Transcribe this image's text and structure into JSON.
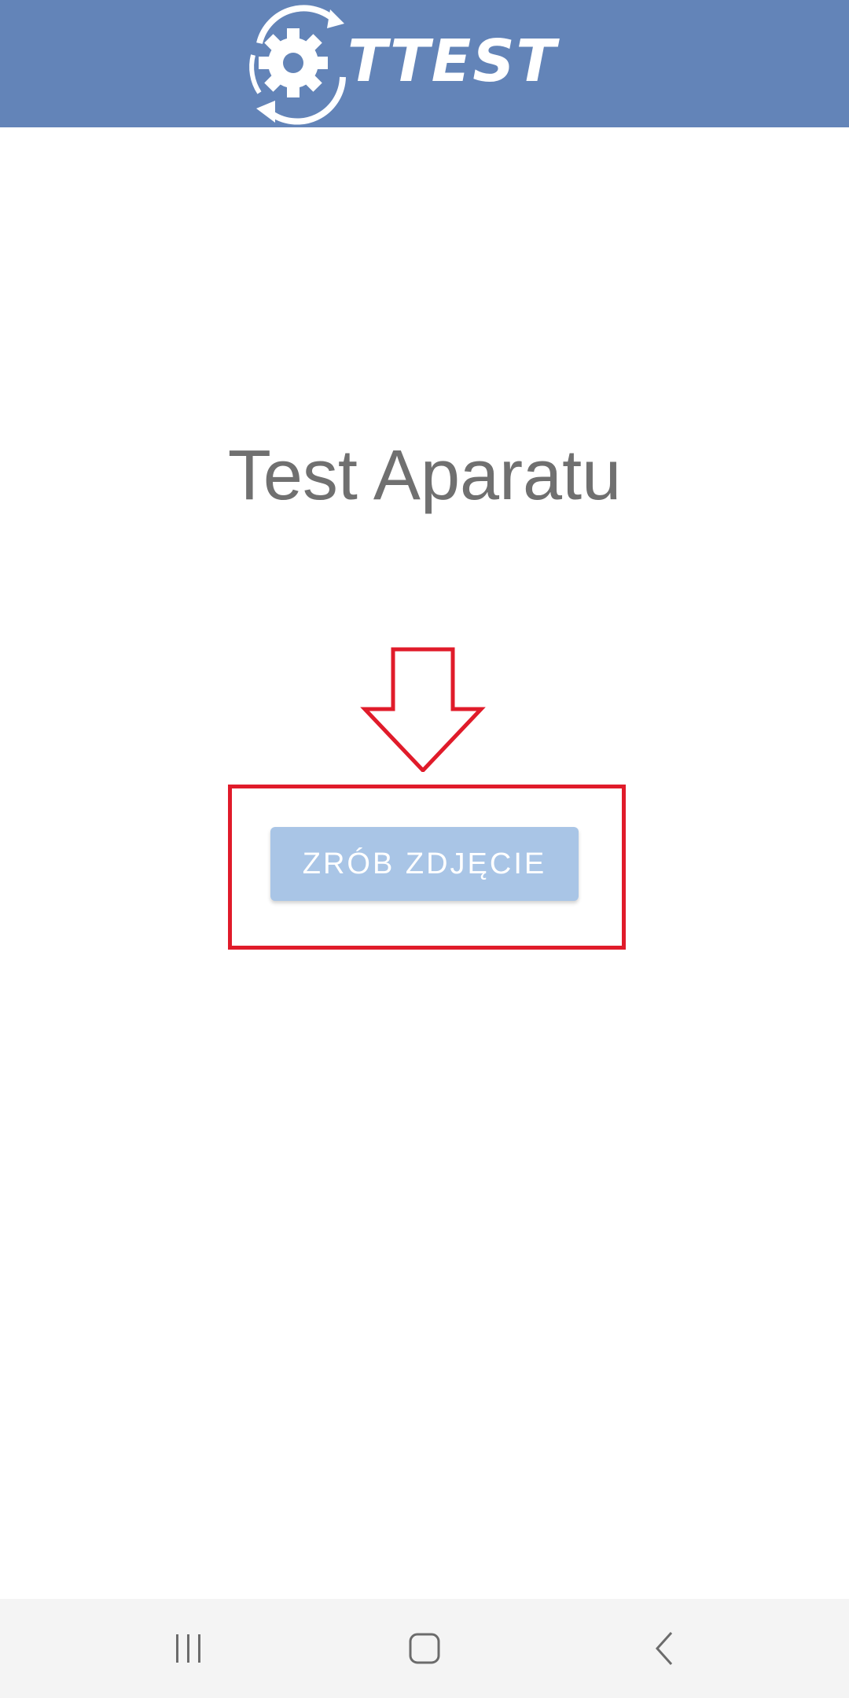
{
  "header": {
    "logo_text": "TTEST",
    "background_color": "#6384b8",
    "logo_icon": "gear-refresh-icon"
  },
  "main": {
    "title": "Test Aparatu",
    "capture_button_label": "ZRÓB ZDJĘCIE",
    "button_color": "#a9c5e6",
    "annotation_color": "#e01b2a",
    "annotation_icon": "down-arrow-icon"
  },
  "nav_bar": {
    "recents_icon": "recents-icon",
    "home_icon": "home-icon",
    "back_icon": "back-icon"
  }
}
